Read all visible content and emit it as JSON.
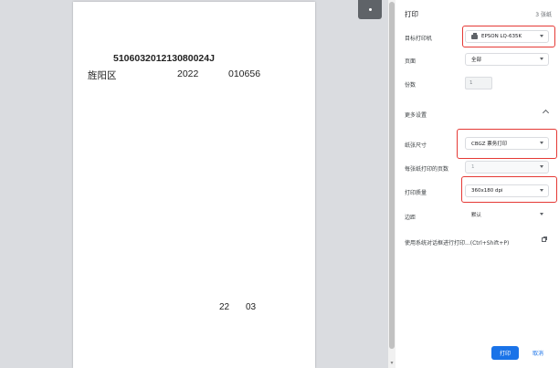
{
  "preview": {
    "code": "510603201213080024J",
    "district": "旌阳区",
    "year": "2022",
    "number": "010656",
    "date_day": "22",
    "date_month": "03"
  },
  "panel": {
    "title": "打印",
    "sheet_count": "3 张纸",
    "destination_label": "目标打印机",
    "destination_value": "EPSON LQ-635K",
    "pages_label": "页面",
    "pages_value": "全部",
    "copies_label": "份数",
    "copies_value": "1",
    "more_settings_label": "更多设置",
    "paper_size_label": "纸张尺寸",
    "paper_size_value": "CBGZ 票务打印",
    "pages_per_sheet_label": "每张纸打印的页数",
    "pages_per_sheet_value": "1",
    "quality_label": "打印质量",
    "quality_value": "360x180 dpi",
    "margins_label": "边距",
    "margins_value": "默认",
    "system_dialog_label": "使用系统对话框进行打印...(Ctrl+Shift+P)",
    "print_button": "打印",
    "cancel_button": "取消"
  },
  "colors": {
    "accent": "#1a73e8",
    "highlight": "#e53935"
  }
}
